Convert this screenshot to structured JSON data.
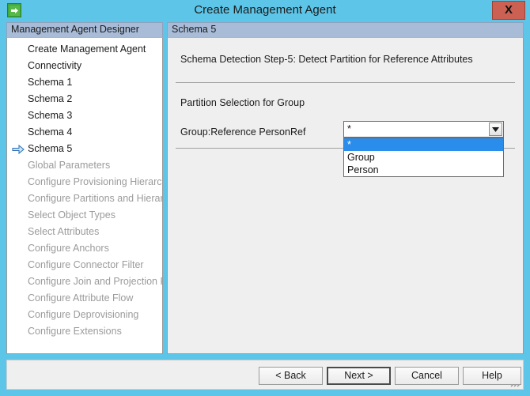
{
  "window": {
    "title": "Create Management Agent",
    "icon": "arrow-right-green-icon",
    "close_label": "X"
  },
  "headers": {
    "left": "Management Agent Designer",
    "right": "Schema 5"
  },
  "sidebar": {
    "items": [
      {
        "label": "Create Management Agent",
        "state": "done",
        "current": false
      },
      {
        "label": "Connectivity",
        "state": "done",
        "current": false
      },
      {
        "label": "Schema 1",
        "state": "done",
        "current": false
      },
      {
        "label": "Schema 2",
        "state": "done",
        "current": false
      },
      {
        "label": "Schema 3",
        "state": "done",
        "current": false
      },
      {
        "label": "Schema 4",
        "state": "done",
        "current": false
      },
      {
        "label": "Schema 5",
        "state": "done",
        "current": true
      },
      {
        "label": "Global Parameters",
        "state": "disabled",
        "current": false
      },
      {
        "label": "Configure Provisioning Hierarchy",
        "state": "disabled",
        "current": false
      },
      {
        "label": "Configure Partitions and Hierarchies",
        "state": "disabled",
        "current": false
      },
      {
        "label": "Select Object Types",
        "state": "disabled",
        "current": false
      },
      {
        "label": "Select Attributes",
        "state": "disabled",
        "current": false
      },
      {
        "label": "Configure Anchors",
        "state": "disabled",
        "current": false
      },
      {
        "label": "Configure Connector Filter",
        "state": "disabled",
        "current": false
      },
      {
        "label": "Configure Join and Projection Rules",
        "state": "disabled",
        "current": false
      },
      {
        "label": "Configure Attribute Flow",
        "state": "disabled",
        "current": false
      },
      {
        "label": "Configure Deprovisioning",
        "state": "disabled",
        "current": false
      },
      {
        "label": "Configure Extensions",
        "state": "disabled",
        "current": false
      }
    ]
  },
  "main": {
    "step_title": "Schema Detection Step-5: Detect Partition for Reference Attributes",
    "section_label": "Partition Selection for Group",
    "field_label": "Group:Reference PersonRef",
    "combo": {
      "value": "*",
      "expanded": true,
      "options": [
        {
          "label": "*",
          "selected": true
        },
        {
          "label": "Group",
          "selected": false
        },
        {
          "label": "Person",
          "selected": false
        }
      ]
    }
  },
  "footer": {
    "buttons": [
      {
        "label": "< Back",
        "focused": false
      },
      {
        "label": "Next >",
        "focused": true
      },
      {
        "label": "Cancel",
        "focused": false
      },
      {
        "label": "Help",
        "focused": false
      }
    ]
  },
  "colors": {
    "titlebar": "#5cc5e8",
    "header_strip": "#a8bcd8",
    "close_button": "#cc6153",
    "highlight": "#2a8ceb",
    "pane_bg": "#efefef"
  }
}
